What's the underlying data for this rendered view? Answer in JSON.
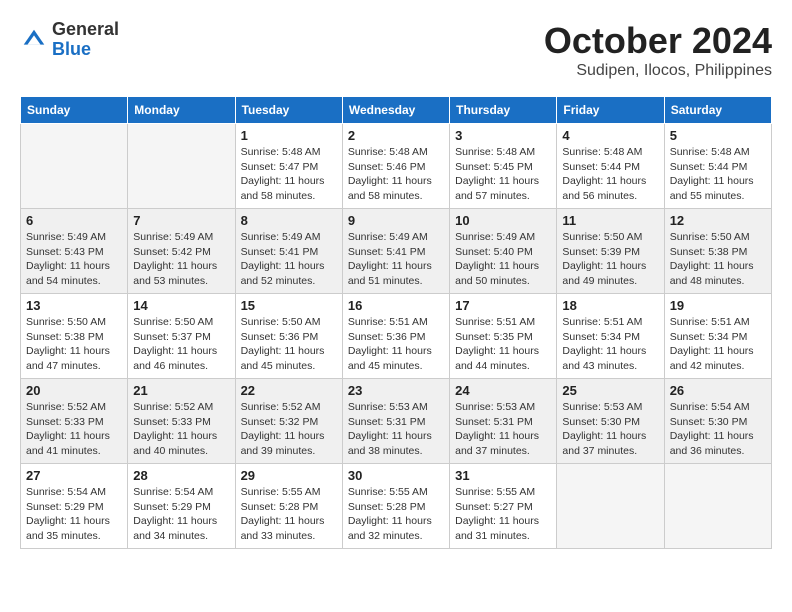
{
  "header": {
    "logo_general": "General",
    "logo_blue": "Blue",
    "month_title": "October 2024",
    "subtitle": "Sudipen, Ilocos, Philippines"
  },
  "weekdays": [
    "Sunday",
    "Monday",
    "Tuesday",
    "Wednesday",
    "Thursday",
    "Friday",
    "Saturday"
  ],
  "weeks": [
    [
      {
        "day": "",
        "sunrise": "",
        "sunset": "",
        "daylight": ""
      },
      {
        "day": "",
        "sunrise": "",
        "sunset": "",
        "daylight": ""
      },
      {
        "day": "1",
        "sunrise": "Sunrise: 5:48 AM",
        "sunset": "Sunset: 5:47 PM",
        "daylight": "Daylight: 11 hours and 58 minutes."
      },
      {
        "day": "2",
        "sunrise": "Sunrise: 5:48 AM",
        "sunset": "Sunset: 5:46 PM",
        "daylight": "Daylight: 11 hours and 58 minutes."
      },
      {
        "day": "3",
        "sunrise": "Sunrise: 5:48 AM",
        "sunset": "Sunset: 5:45 PM",
        "daylight": "Daylight: 11 hours and 57 minutes."
      },
      {
        "day": "4",
        "sunrise": "Sunrise: 5:48 AM",
        "sunset": "Sunset: 5:44 PM",
        "daylight": "Daylight: 11 hours and 56 minutes."
      },
      {
        "day": "5",
        "sunrise": "Sunrise: 5:48 AM",
        "sunset": "Sunset: 5:44 PM",
        "daylight": "Daylight: 11 hours and 55 minutes."
      }
    ],
    [
      {
        "day": "6",
        "sunrise": "Sunrise: 5:49 AM",
        "sunset": "Sunset: 5:43 PM",
        "daylight": "Daylight: 11 hours and 54 minutes."
      },
      {
        "day": "7",
        "sunrise": "Sunrise: 5:49 AM",
        "sunset": "Sunset: 5:42 PM",
        "daylight": "Daylight: 11 hours and 53 minutes."
      },
      {
        "day": "8",
        "sunrise": "Sunrise: 5:49 AM",
        "sunset": "Sunset: 5:41 PM",
        "daylight": "Daylight: 11 hours and 52 minutes."
      },
      {
        "day": "9",
        "sunrise": "Sunrise: 5:49 AM",
        "sunset": "Sunset: 5:41 PM",
        "daylight": "Daylight: 11 hours and 51 minutes."
      },
      {
        "day": "10",
        "sunrise": "Sunrise: 5:49 AM",
        "sunset": "Sunset: 5:40 PM",
        "daylight": "Daylight: 11 hours and 50 minutes."
      },
      {
        "day": "11",
        "sunrise": "Sunrise: 5:50 AM",
        "sunset": "Sunset: 5:39 PM",
        "daylight": "Daylight: 11 hours and 49 minutes."
      },
      {
        "day": "12",
        "sunrise": "Sunrise: 5:50 AM",
        "sunset": "Sunset: 5:38 PM",
        "daylight": "Daylight: 11 hours and 48 minutes."
      }
    ],
    [
      {
        "day": "13",
        "sunrise": "Sunrise: 5:50 AM",
        "sunset": "Sunset: 5:38 PM",
        "daylight": "Daylight: 11 hours and 47 minutes."
      },
      {
        "day": "14",
        "sunrise": "Sunrise: 5:50 AM",
        "sunset": "Sunset: 5:37 PM",
        "daylight": "Daylight: 11 hours and 46 minutes."
      },
      {
        "day": "15",
        "sunrise": "Sunrise: 5:50 AM",
        "sunset": "Sunset: 5:36 PM",
        "daylight": "Daylight: 11 hours and 45 minutes."
      },
      {
        "day": "16",
        "sunrise": "Sunrise: 5:51 AM",
        "sunset": "Sunset: 5:36 PM",
        "daylight": "Daylight: 11 hours and 45 minutes."
      },
      {
        "day": "17",
        "sunrise": "Sunrise: 5:51 AM",
        "sunset": "Sunset: 5:35 PM",
        "daylight": "Daylight: 11 hours and 44 minutes."
      },
      {
        "day": "18",
        "sunrise": "Sunrise: 5:51 AM",
        "sunset": "Sunset: 5:34 PM",
        "daylight": "Daylight: 11 hours and 43 minutes."
      },
      {
        "day": "19",
        "sunrise": "Sunrise: 5:51 AM",
        "sunset": "Sunset: 5:34 PM",
        "daylight": "Daylight: 11 hours and 42 minutes."
      }
    ],
    [
      {
        "day": "20",
        "sunrise": "Sunrise: 5:52 AM",
        "sunset": "Sunset: 5:33 PM",
        "daylight": "Daylight: 11 hours and 41 minutes."
      },
      {
        "day": "21",
        "sunrise": "Sunrise: 5:52 AM",
        "sunset": "Sunset: 5:33 PM",
        "daylight": "Daylight: 11 hours and 40 minutes."
      },
      {
        "day": "22",
        "sunrise": "Sunrise: 5:52 AM",
        "sunset": "Sunset: 5:32 PM",
        "daylight": "Daylight: 11 hours and 39 minutes."
      },
      {
        "day": "23",
        "sunrise": "Sunrise: 5:53 AM",
        "sunset": "Sunset: 5:31 PM",
        "daylight": "Daylight: 11 hours and 38 minutes."
      },
      {
        "day": "24",
        "sunrise": "Sunrise: 5:53 AM",
        "sunset": "Sunset: 5:31 PM",
        "daylight": "Daylight: 11 hours and 37 minutes."
      },
      {
        "day": "25",
        "sunrise": "Sunrise: 5:53 AM",
        "sunset": "Sunset: 5:30 PM",
        "daylight": "Daylight: 11 hours and 37 minutes."
      },
      {
        "day": "26",
        "sunrise": "Sunrise: 5:54 AM",
        "sunset": "Sunset: 5:30 PM",
        "daylight": "Daylight: 11 hours and 36 minutes."
      }
    ],
    [
      {
        "day": "27",
        "sunrise": "Sunrise: 5:54 AM",
        "sunset": "Sunset: 5:29 PM",
        "daylight": "Daylight: 11 hours and 35 minutes."
      },
      {
        "day": "28",
        "sunrise": "Sunrise: 5:54 AM",
        "sunset": "Sunset: 5:29 PM",
        "daylight": "Daylight: 11 hours and 34 minutes."
      },
      {
        "day": "29",
        "sunrise": "Sunrise: 5:55 AM",
        "sunset": "Sunset: 5:28 PM",
        "daylight": "Daylight: 11 hours and 33 minutes."
      },
      {
        "day": "30",
        "sunrise": "Sunrise: 5:55 AM",
        "sunset": "Sunset: 5:28 PM",
        "daylight": "Daylight: 11 hours and 32 minutes."
      },
      {
        "day": "31",
        "sunrise": "Sunrise: 5:55 AM",
        "sunset": "Sunset: 5:27 PM",
        "daylight": "Daylight: 11 hours and 31 minutes."
      },
      {
        "day": "",
        "sunrise": "",
        "sunset": "",
        "daylight": ""
      },
      {
        "day": "",
        "sunrise": "",
        "sunset": "",
        "daylight": ""
      }
    ]
  ]
}
